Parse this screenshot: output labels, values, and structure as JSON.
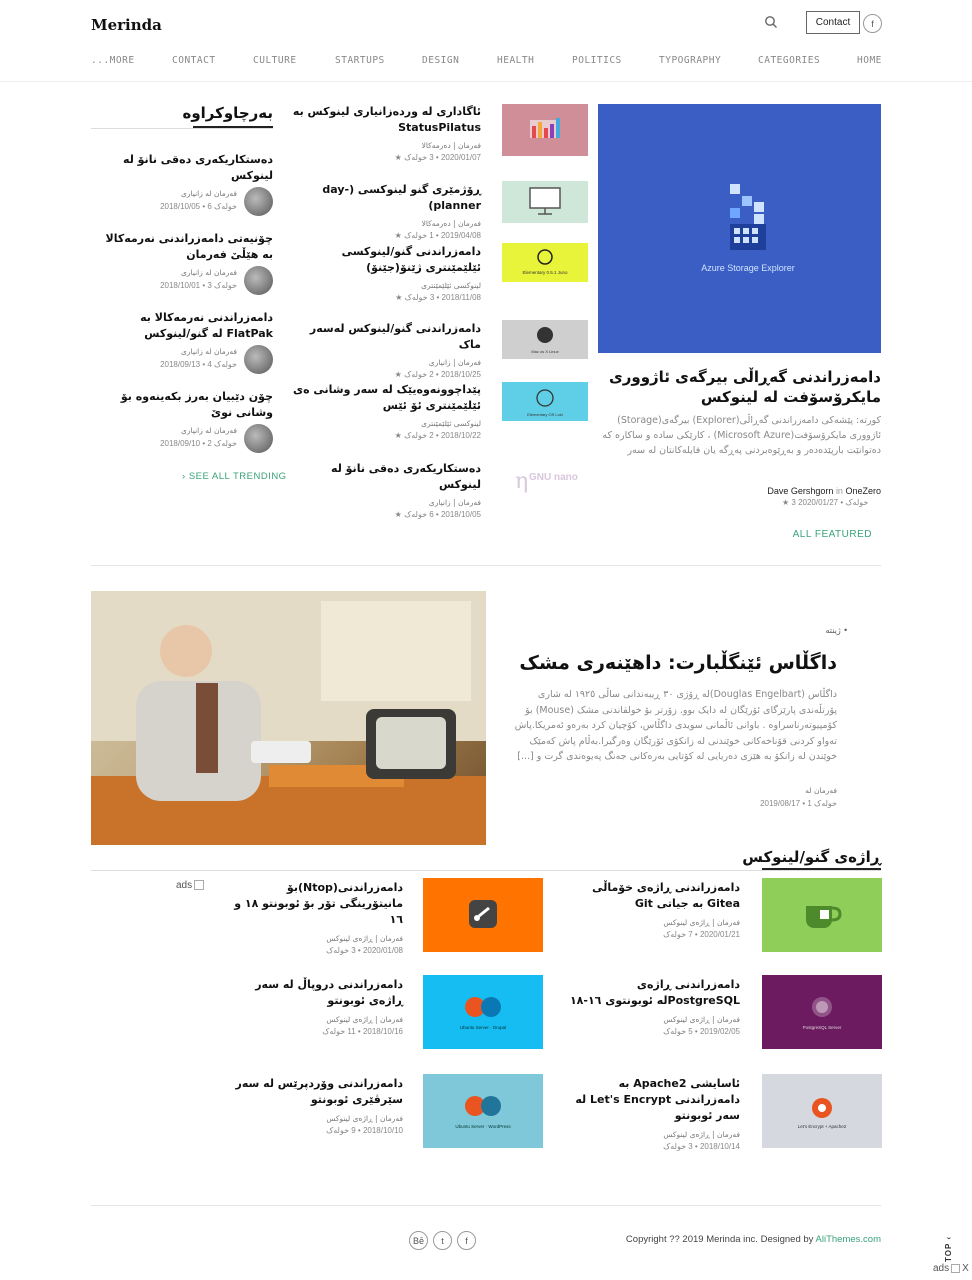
{
  "header": {
    "logo": "Merinda",
    "contact_label": "Contact",
    "fb_glyph": "f",
    "nav": [
      "...MORE",
      "CONTACT",
      "CULTURE",
      "STARTUPS",
      "DESIGN",
      "HEALTH",
      "POLITICS",
      "TYPOGRAPHY",
      "CATEGORIES",
      "HOME"
    ]
  },
  "featured": {
    "image_caption": "Azure Storage Explorer",
    "title": "دامەزراندنی گەڕاڵی بیرگەی ئاژووری مایکرۆسۆفت لە لینوکس",
    "excerpt": "کورتە: پێشەکی دامەزراندنی گەڕاڵی(Explorer) بیرگەی(Storage) ئاژووری مایکرۆسۆفت(Microsoft Azure) ، کارێکی سادە و ساکارە کە دەتوانێت بارپێدەدەر و بەڕێوەبردنی پەڕگە یان فایلەکانتان لە سەر",
    "author": "Dave Gershgorn",
    "in_word": "in",
    "publication": "OneZero",
    "date": "2020/01/27",
    "read": "3 خولەک",
    "all_label": "ALL FEATURED"
  },
  "middle": [
    {
      "title": "ئاگاداری لە وردەزانیاری لینوکس بە StatusPilatus",
      "cat": "فەرمان | دەرمەکالا",
      "date": "2020/01/07",
      "read": "3 خولەک"
    },
    {
      "title": "ڕۆژمێری گنو لینوکسی (day-planner)",
      "cat": "فەرمان | دەرمەکالا",
      "date": "2019/04/08",
      "read": "1 خولەک"
    },
    {
      "title": "دامەزراندنی گنو/لینوکسی ئێلێمێنتری ژێنۆ(جێنۆ)",
      "cat": "لینوکسی ئێلێمێنتری",
      "date": "2018/11/08",
      "read": "3 خولەک"
    },
    {
      "title": "دامەزراندنی گنو/لینوکس لەسەر ماک",
      "cat": "فەرمان | زانیاری",
      "date": "2018/10/25",
      "read": "2 خولەک"
    },
    {
      "title": "پێداچوونەوەیێک لە سەر وشانی ەی ئێلێمێنتری ئۆ ئێس",
      "cat": "لینوکسی ئێلێمێنتری",
      "date": "2018/10/22",
      "read": "2 خولەک"
    },
    {
      "title": "دەستکاریکەری دەقی نانۆ لە لینوکس",
      "cat": "فەرمان | زانیاری",
      "date": "2018/10/05",
      "read": "6 خولەک"
    }
  ],
  "thumbs": {
    "t3_caption": "Elementary 0.5.1 Juno",
    "t4_caption": "Mac os X Linux",
    "t5_caption": "Elementary OS Loki",
    "t6_caption": "GNU nano"
  },
  "trending": {
    "heading": "بەرچاوکراوە",
    "items": [
      {
        "title": "دەستکاریکەری دەقی نانۆ لە لینوکس",
        "cat": "فەرمان لە زانیاری",
        "date": "2018/10/05",
        "read": "6 خولەک"
      },
      {
        "title": "چۆنیەتی دامەزراندنی نەرمەکالا بە هێڵێ فەرمان",
        "cat": "فەرمان لە زانیاری",
        "date": "2018/10/01",
        "read": "3 خولەک"
      },
      {
        "title": "دامەزراندنی نەرمەکالا بە FlatPak لە گنو/لینوکس",
        "cat": "فەرمان لە زانیاری",
        "date": "2018/09/13",
        "read": "4 خولەک"
      },
      {
        "title": "چۆن دێبیان بەرز بکەینەوە بۆ وشانی نوێ",
        "cat": "فەرمان لە زانیاری",
        "date": "2018/09/10",
        "read": "2 خولەک"
      }
    ],
    "see_all": "SEE ALL TRENDING"
  },
  "story": {
    "cat": "ژینتە",
    "title": "داگڵاس ئێنگڵبارت: داهێنەری مشک",
    "excerpt": "داگڵاس (Douglas Engelbart)لە ڕۆژی ٣٠ ڕیبەندانی ساڵی ١٩٢٥ لە شاری پۆرتڵەندی پارێزگای ئۆرێگان لە دایک بوو. زۆرتر بۆ خولقاندنی مشک (Mouse) بۆ کۆمپیوتەرناسراوە . باوانی ئاڵمانی سویدی داگڵاس، کۆچیان کرد بەرەو ئەمریکا.پاش تەواو کردنی قۆناخەکانی خوێندنی لە زانکۆی ئۆرێگان وەرگیرا.بەڵام پاش کەمێک خوێندن لە زانکۆ بە هێزی دەریایی لە کۆتایی بەرەکانی جەنگ پەیوەندی گرت و [...]",
    "author": "فەرمان لە",
    "date": "2019/08/17",
    "read": "1 خولەک"
  },
  "section": {
    "heading": "ڕاژەی گنو/لینوکس",
    "items": [
      {
        "title": "دامەزراندنی ڕاژەی خۆماڵی Gitea بە جیاتی Git",
        "cat": "فەرمان | ڕاژەی لینوکس",
        "date": "2020/01/21",
        "read": "7 خولەک",
        "color": "#8fce58"
      },
      {
        "title": "دامەزراندنی(Ntop)بۆ مانیتۆرینگی تۆر بۆ ئوبونتو ١٨ و ١٦",
        "cat": "فەرمان | ڕاژەی لینوکس",
        "date": "2020/01/08",
        "read": "3 خولەک",
        "color": "#ff7300"
      },
      {
        "title": "دامەزراندنی ڕاژەی PostgreSQLلە ئوبونتوی ١٦-١٨",
        "cat": "فەرمان | ڕاژەی لینوکس",
        "date": "2019/02/05",
        "read": "5 خولەک",
        "color": "#6d1b60"
      },
      {
        "title": "دامەزراندنی دروپاڵ لە سەر ڕاژەی ئوبونتو",
        "cat": "فەرمان | ڕاژەی لینوکس",
        "date": "2018/10/16",
        "read": "11 خولەک",
        "color": "#16bdf2"
      },
      {
        "title": "ئاسایشی Apache2 بە دامەزراندنی Let's Encrypt لە سەر ئوبونتو",
        "cat": "فەرمان | ڕاژەی لینوکس",
        "date": "2018/10/14",
        "read": "3 خولەک",
        "color": "#d6d8e0"
      },
      {
        "title": "دامەزراندنی وۆردپرێس لە سەر سێرڤێری ئوبونتو",
        "cat": "فەرمان | ڕاژەی لینوکس",
        "date": "2018/10/10",
        "read": "9 خولەک",
        "color": "#7ec8d9"
      }
    ],
    "img_captions": {
      "postgres": "PostgreSQL Server",
      "drupal": "Ubuntu Server · Drupal",
      "letsencrypt": "Let's Encrypt + Apache2",
      "wordpress": "Ubuntu Server · WordPress"
    }
  },
  "ads": {
    "mid": "ads",
    "corner": "ads",
    "close": "X"
  },
  "footer": {
    "copyright_prefix": "Copyright ?? 2019 Merinda inc. Designed by",
    "designer": "AliThemes.com",
    "social": [
      "Bē",
      "t",
      "f"
    ],
    "top_label": "TOP"
  },
  "colors": {
    "accent": "#3aa37a",
    "featured_bg": "#3a5ec4"
  }
}
